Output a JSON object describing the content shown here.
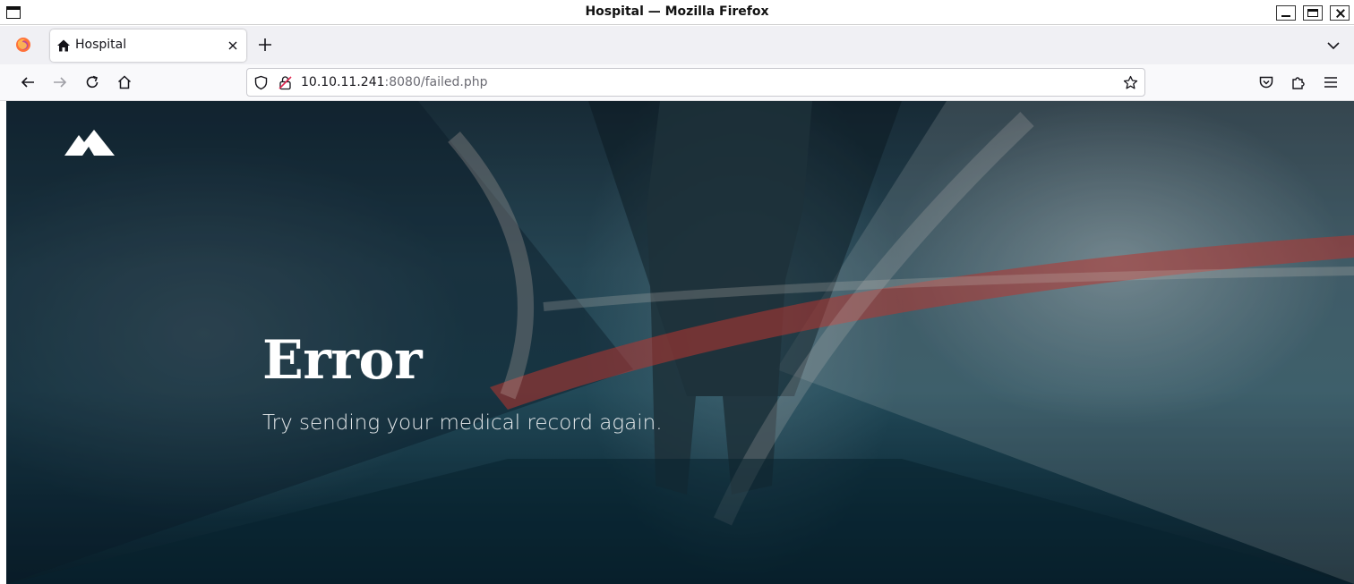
{
  "window": {
    "title": "Hospital — Mozilla Firefox"
  },
  "tabs": [
    {
      "label": "Hospital",
      "icon": "home-icon",
      "active": true
    }
  ],
  "navbar": {
    "url_host": "10.10.11.241",
    "url_rest": ":8080/failed.php"
  },
  "page": {
    "logo": "mountain-logo",
    "title": "Error",
    "subtitle": "Try sending your medical record again."
  },
  "colors": {
    "page_background": "#2a5a6c",
    "hero_text": "#ffffff",
    "accent_beam": "#e0413a"
  }
}
